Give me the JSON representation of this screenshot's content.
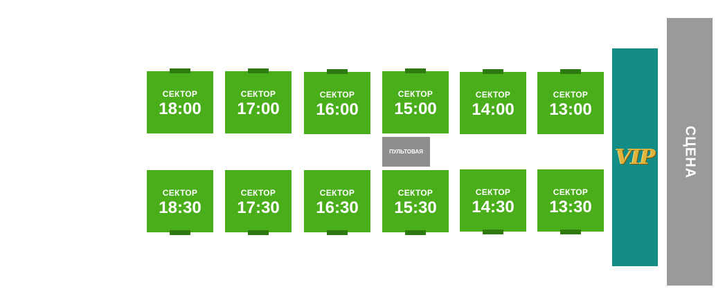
{
  "sectors_top": [
    {
      "label": "СЕКТОР",
      "time": "18:00"
    },
    {
      "label": "СЕКТОР",
      "time": "17:00"
    },
    {
      "label": "СЕКТОР",
      "time": "16:00"
    },
    {
      "label": "СЕКТОР",
      "time": "15:00"
    },
    {
      "label": "СЕКТОР",
      "time": "14:00"
    },
    {
      "label": "СЕКТОР",
      "time": "13:00"
    }
  ],
  "sectors_bottom": [
    {
      "label": "СЕКТОР",
      "time": "18:30"
    },
    {
      "label": "СЕКТОР",
      "time": "17:30"
    },
    {
      "label": "СЕКТОР",
      "time": "16:30"
    },
    {
      "label": "СЕКТОР",
      "time": "15:30"
    },
    {
      "label": "СЕКТОР",
      "time": "14:30"
    },
    {
      "label": "СЕКТОР",
      "time": "13:30"
    }
  ],
  "console": "ПУЛЬТОВАЯ",
  "vip": "VIP",
  "stage": "СЦЕНА",
  "colors": {
    "sector": "#4aad1a",
    "sector_tab": "#2f7a10",
    "console": "#8e8e8e",
    "vip": "#138c86",
    "vip_text": "#e0b43a",
    "stage": "#9a9a9a"
  }
}
